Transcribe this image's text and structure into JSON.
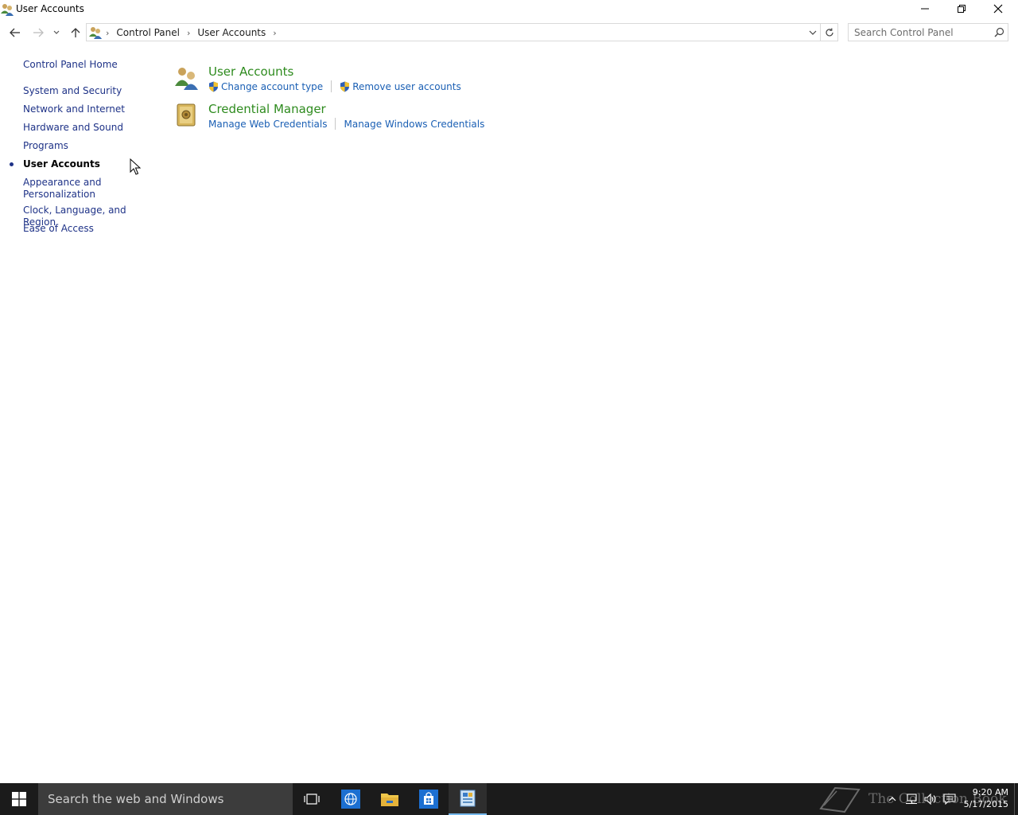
{
  "window": {
    "title": "User Accounts"
  },
  "address": {
    "crumbs": [
      "Control Panel",
      "User Accounts"
    ],
    "search_placeholder": "Search Control Panel"
  },
  "leftnav": {
    "home": "Control Panel Home",
    "items": [
      {
        "label": "System and Security"
      },
      {
        "label": "Network and Internet"
      },
      {
        "label": "Hardware and Sound"
      },
      {
        "label": "Programs"
      },
      {
        "label": "User Accounts",
        "current": true
      },
      {
        "label": "Appearance and",
        "label2": "Personalization"
      },
      {
        "label": "Clock, Language, and Region"
      },
      {
        "label": "Ease of Access"
      }
    ]
  },
  "content": {
    "categories": [
      {
        "title": "User Accounts",
        "links": [
          "Change account type",
          "Remove user accounts"
        ]
      },
      {
        "title": "Credential Manager",
        "links": [
          "Manage Web Credentials",
          "Manage Windows Credentials"
        ]
      }
    ]
  },
  "taskbar": {
    "search_text": "Search the web and Windows",
    "watermark": "The Collection Book",
    "time": "9:20 AM",
    "date": "5/17/2015"
  },
  "colors": {
    "link": "#1a5fb4",
    "category_title": "#2e8b1e",
    "nav_link": "#1e3287",
    "taskbar": "#1b1b1b"
  }
}
